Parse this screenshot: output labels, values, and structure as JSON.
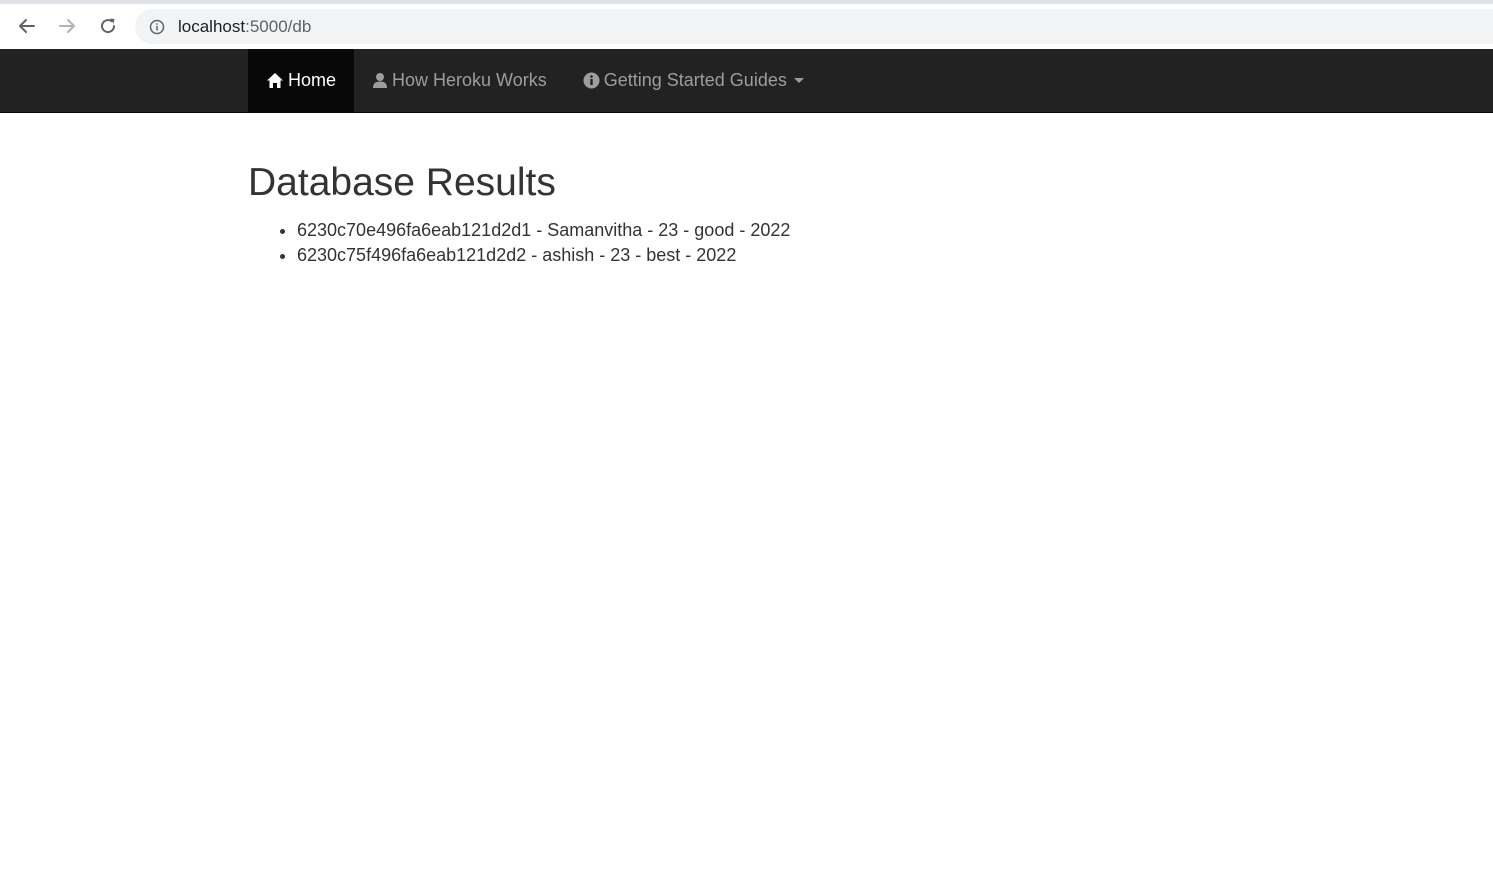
{
  "browser": {
    "url_host": "localhost",
    "url_path": ":5000/db",
    "icons": {
      "back": "back-arrow-icon",
      "forward": "forward-arrow-icon",
      "reload": "reload-icon",
      "site_info": "info-icon"
    }
  },
  "navbar": {
    "items": [
      {
        "label": "Home",
        "icon": "home-icon",
        "active": true
      },
      {
        "label": "How Heroku Works",
        "icon": "user-icon",
        "active": false
      },
      {
        "label": "Getting Started Guides",
        "icon": "info-sign-icon",
        "active": false,
        "dropdown": true
      }
    ]
  },
  "main": {
    "title": "Database Results",
    "results": [
      "6230c70e496fa6eab121d2d1 - Samanvitha - 23 - good - 2022",
      "6230c75f496fa6eab121d2d2 - ashish - 23 - best - 2022"
    ]
  },
  "colors": {
    "navbar_bg": "#222222",
    "navbar_active_bg": "#080808",
    "navbar_text": "#9d9d9d",
    "text": "#333333"
  }
}
